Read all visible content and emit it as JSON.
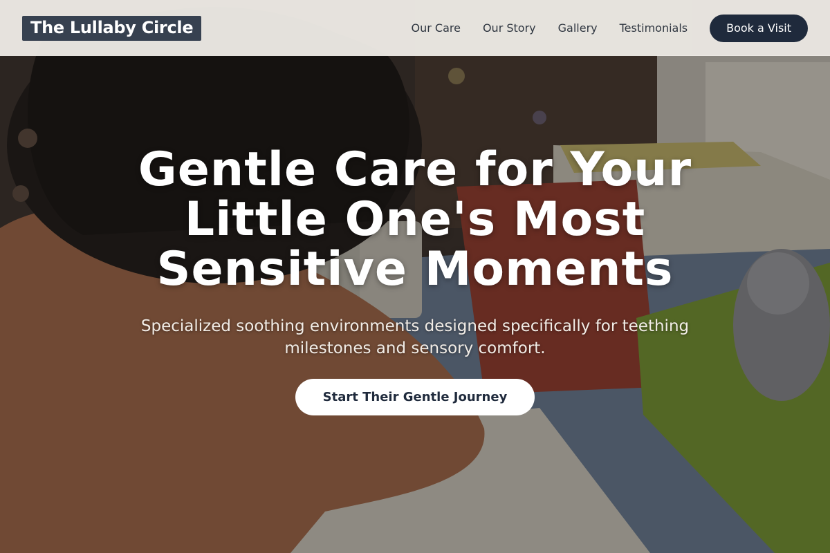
{
  "header": {
    "logo": "The Lullaby Circle",
    "nav": [
      {
        "label": "Our Care"
      },
      {
        "label": "Our Story"
      },
      {
        "label": "Gallery"
      },
      {
        "label": "Testimonials"
      }
    ],
    "book_label": "Book a Visit"
  },
  "hero": {
    "title": "Gentle Care for Your Little One's Most Sensitive Moments",
    "subtitle": "Specialized soothing environments designed specifically for teething milestones and sensory comfort.",
    "cta_label": "Start Their Gentle Journey",
    "image_name": "child-studying-at-desk-photo"
  },
  "colors": {
    "header_bg": "#f4f1ec",
    "logo_bg": "#374150",
    "button_dark": "#1f2a3c",
    "cta_bg": "#ffffff"
  }
}
